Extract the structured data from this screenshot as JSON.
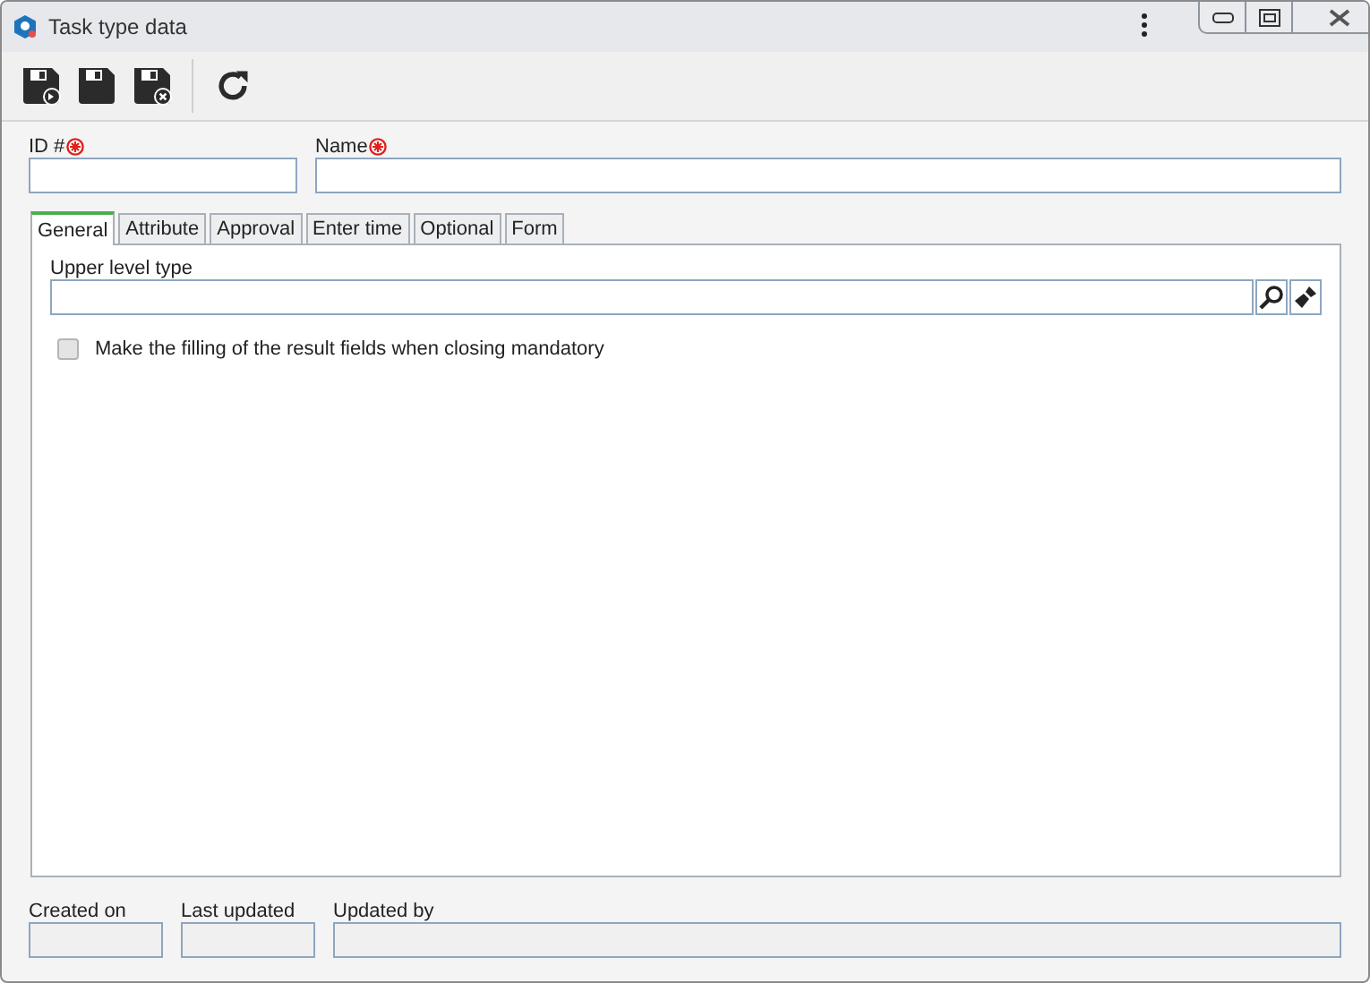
{
  "window": {
    "title": "Task type data"
  },
  "toolbar": [
    {
      "kind": "save-new"
    },
    {
      "kind": "save"
    },
    {
      "kind": "save-close"
    },
    {
      "kind": "refresh"
    }
  ],
  "fields": [
    {
      "label": "ID #",
      "required": true
    },
    {
      "label": "Name",
      "required": true
    }
  ],
  "tabs": [
    {
      "label": "General",
      "selected": true
    },
    {
      "label": "Attribute",
      "selected": false
    },
    {
      "label": "Approval",
      "selected": false
    },
    {
      "label": "Enter time",
      "selected": false
    },
    {
      "label": "Optional",
      "selected": false
    },
    {
      "label": "Form",
      "selected": false
    }
  ],
  "general": {
    "upper_level_type": {
      "label": "Upper level type"
    },
    "checkbox": {
      "label": "Make the filling of the result fields when closing mandatory",
      "checked": false
    }
  },
  "footer": [
    {
      "label": "Created on"
    },
    {
      "label": "Last updated"
    },
    {
      "label": "Updated by"
    }
  ]
}
